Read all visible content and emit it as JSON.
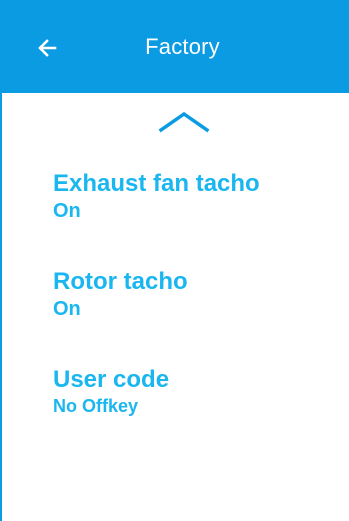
{
  "colors": {
    "header_background": "#0a9be3",
    "accent": "#1ab6ef",
    "background": "#ffffff",
    "header_text": "#ffffff"
  },
  "header": {
    "title": "Factory",
    "back_icon": "arrow-left-icon"
  },
  "navigation": {
    "scroll_up_icon": "chevron-up-icon"
  },
  "settings": [
    {
      "label": "Exhaust fan tacho",
      "value": "On"
    },
    {
      "label": "Rotor tacho",
      "value": "On"
    },
    {
      "label": "User code",
      "value": "No Offkey"
    }
  ]
}
